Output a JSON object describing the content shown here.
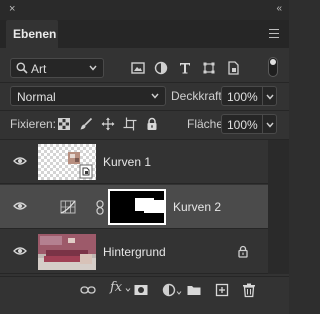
{
  "window": {
    "close_glyph": "×",
    "collapse_glyph": "«"
  },
  "panel": {
    "tab_label": "Ebenen"
  },
  "filter": {
    "selected": "Art"
  },
  "filter_icons": [
    "image-filter-icon",
    "adjustment-filter-icon",
    "type-filter-icon",
    "shape-filter-icon",
    "smartobject-filter-icon"
  ],
  "blend_mode": {
    "value": "Normal"
  },
  "opacity": {
    "label": "Deckkraft:",
    "value": "100%"
  },
  "lock": {
    "label": "Fixieren:"
  },
  "fill": {
    "label": "Fläche:",
    "value": "100%"
  },
  "layers": [
    {
      "name": "Kurven 1",
      "visible": true,
      "selected": false,
      "type": "smart-object"
    },
    {
      "name": "Kurven 2",
      "visible": true,
      "selected": true,
      "type": "adjustment-curves",
      "has_mask": true,
      "mask_linked": true
    },
    {
      "name": "Hintergrund",
      "visible": true,
      "selected": false,
      "type": "background",
      "locked": true
    }
  ],
  "bottom_actions": [
    "link-layers",
    "add-layer-style",
    "add-mask",
    "new-adjustment-layer",
    "new-group",
    "new-layer",
    "delete-layer"
  ],
  "colors": {
    "panel_bg": "#333333",
    "selected_row": "#4b4b4b",
    "field_bg": "#262626"
  }
}
